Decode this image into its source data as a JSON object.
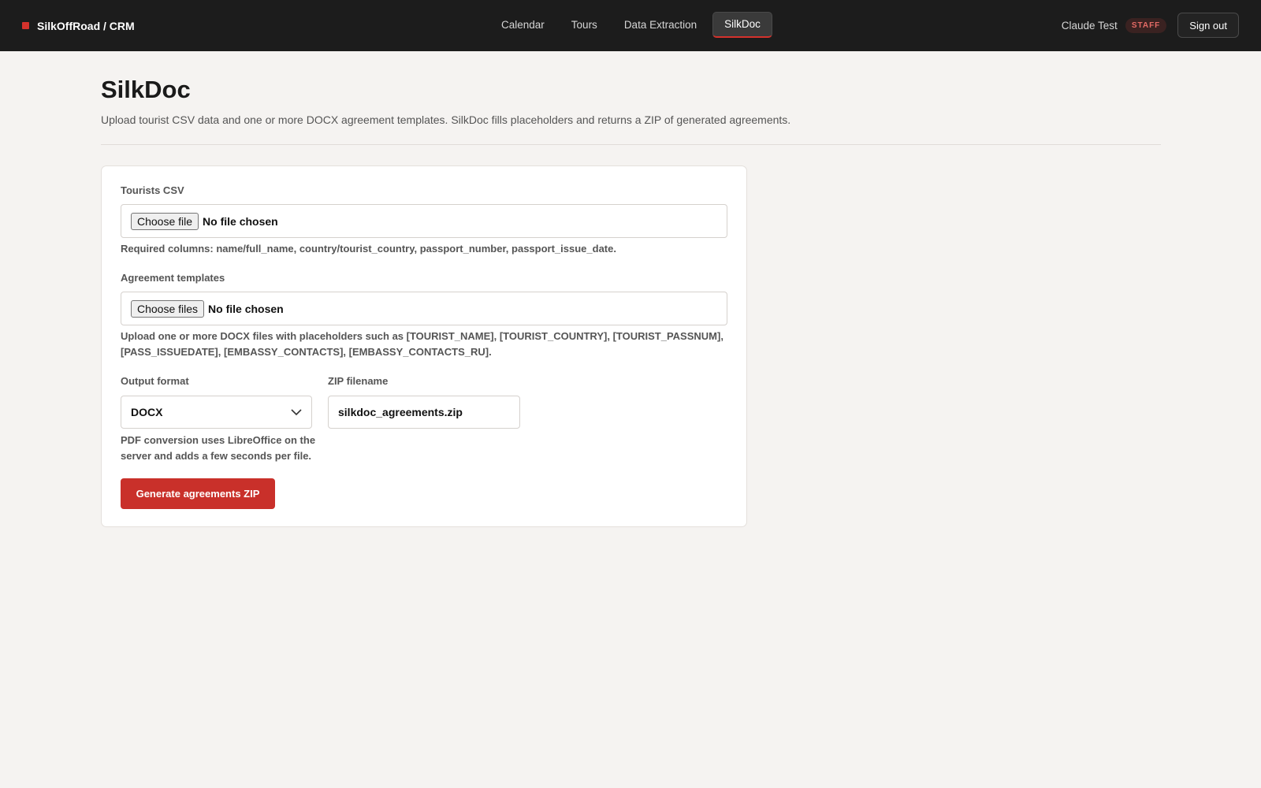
{
  "header": {
    "brand": "SilkOffRoad / CRM",
    "nav": [
      {
        "label": "Calendar"
      },
      {
        "label": "Tours"
      },
      {
        "label": "Data Extraction"
      },
      {
        "label": "SilkDoc",
        "active": true
      }
    ],
    "user_name": "Claude Test",
    "user_badge": "STAFF",
    "signout_label": "Sign out"
  },
  "page": {
    "title": "SilkDoc",
    "subtitle": "Upload tourist CSV data and one or more DOCX agreement templates. SilkDoc fills placeholders and returns a ZIP of generated agreements."
  },
  "form": {
    "csv": {
      "label": "Tourists CSV",
      "button": "Choose file",
      "status": "No file chosen",
      "hint": "Required columns: name/full_name, country/tourist_country, passport_number, passport_issue_date."
    },
    "templates": {
      "label": "Agreement templates",
      "button": "Choose files",
      "status": "No file chosen",
      "hint_line1": "Upload one or more DOCX files with placeholders such as [TOURIST_NAME], [TOURIST_COUNTRY], [TOURIST_PASSNUM],",
      "hint_line2": "[PASS_ISSUEDATE], [EMBASSY_CONTACTS], [EMBASSY_CONTACTS_RU]."
    },
    "output_format": {
      "label": "Output format",
      "value": "DOCX",
      "hint_line1": "PDF conversion uses LibreOffice on the",
      "hint_line2": "server and adds a few seconds per file."
    },
    "zip_filename": {
      "label": "ZIP filename",
      "value": "silkdoc_agreements.zip"
    },
    "submit_label": "Generate agreements ZIP"
  },
  "colors": {
    "accent": "#c9302a",
    "topbar": "#1c1c1c",
    "background": "#f5f3f1"
  }
}
